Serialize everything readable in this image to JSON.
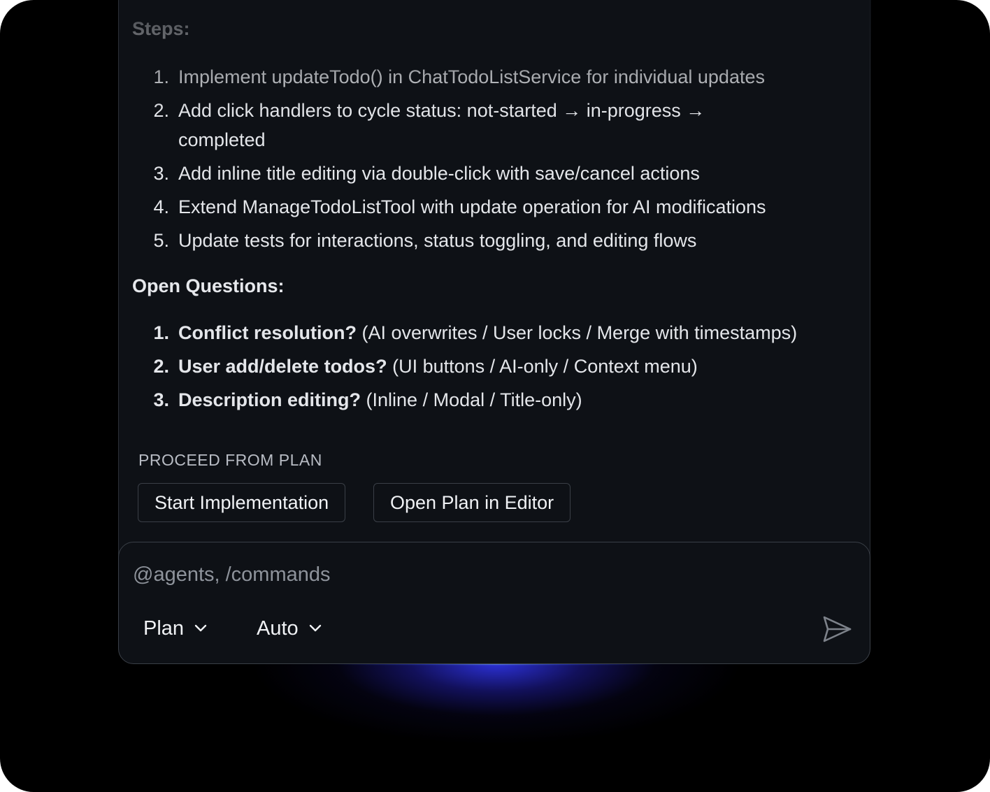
{
  "plan": {
    "steps_heading": "Steps:",
    "steps": [
      {
        "num": "1.",
        "text": "Implement updateTodo() in ChatTodoListService for individual updates"
      },
      {
        "num": "2.",
        "text": "Add click handlers to cycle status: not-started → in-progress → completed"
      },
      {
        "num": "3.",
        "text": "Add inline title editing via double-click with save/cancel actions"
      },
      {
        "num": "4.",
        "text": "Extend ManageTodoListTool with update operation for AI modifications"
      },
      {
        "num": "5.",
        "text": "Update tests for interactions, status toggling, and editing flows"
      }
    ],
    "questions_heading": "Open Questions:",
    "questions": [
      {
        "num": "1.",
        "label": "Conflict resolution?",
        "options": "(AI overwrites / User locks / Merge with timestamps)"
      },
      {
        "num": "2.",
        "label": "User add/delete todos?",
        "options": "(UI buttons / AI-only / Context menu)"
      },
      {
        "num": "3.",
        "label": "Description editing?",
        "options": "(Inline / Modal / Title-only)"
      }
    ]
  },
  "proceed": {
    "label": "PROCEED FROM PLAN",
    "start_button": "Start Implementation",
    "open_button": "Open Plan in Editor"
  },
  "input": {
    "placeholder": "@agents, /commands",
    "mode_value": "Plan",
    "model_value": "Auto",
    "send_icon": "send-icon",
    "chevron_icon": "chevron-down-icon"
  },
  "colors": {
    "panel_bg": "#0e1116",
    "border": "#3a3f47",
    "glow": "#343aff",
    "text": "#e4e6ea"
  }
}
